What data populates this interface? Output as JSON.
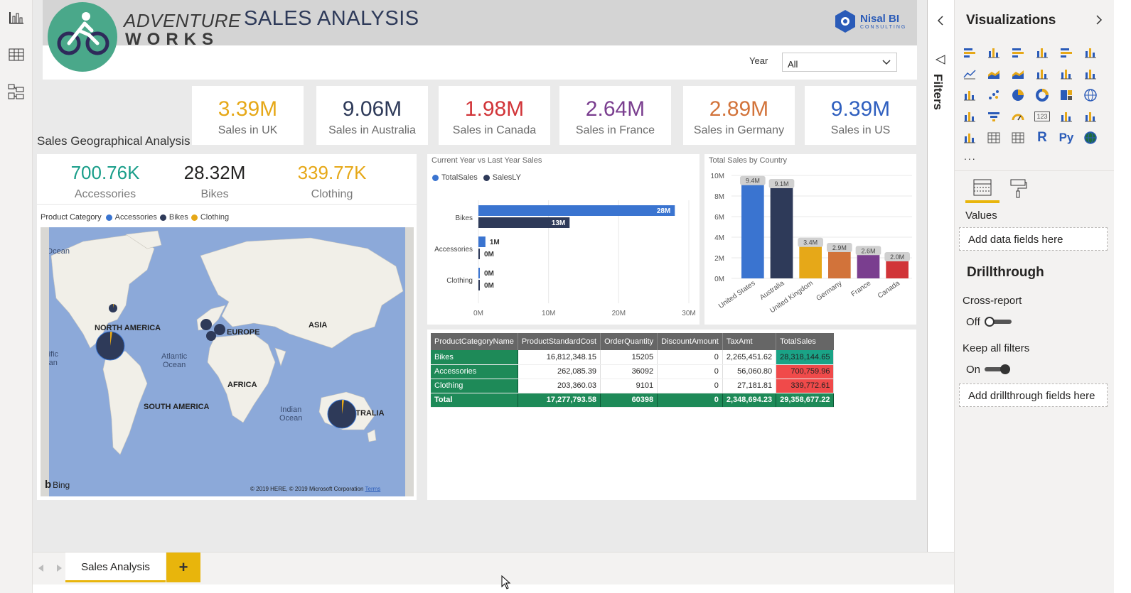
{
  "left_nav": {
    "items": [
      "report-view-icon",
      "data-view-icon",
      "model-view-icon"
    ]
  },
  "header": {
    "brand_line1": "ADVENTURE",
    "brand_line2": "WORKS",
    "title": "SALES ANALYSIS",
    "partner_name": "Nisal BI",
    "partner_sub": "CONSULTING"
  },
  "year_filter": {
    "label": "Year",
    "value": "All"
  },
  "kpis": [
    {
      "value": "3.39M",
      "label": "Sales in UK",
      "color": "#e6a818"
    },
    {
      "value": "9.06M",
      "label": "Sales in Australia",
      "color": "#2e3a59"
    },
    {
      "value": "1.98M",
      "label": "Sales in Canada",
      "color": "#d13438"
    },
    {
      "value": "2.64M",
      "label": "Sales in France",
      "color": "#7a3e8f"
    },
    {
      "value": "2.89M",
      "label": "Sales in Germany",
      "color": "#d2733a"
    },
    {
      "value": "9.39M",
      "label": "Sales in US",
      "color": "#2f5fbf"
    }
  ],
  "geo": {
    "title": "Sales Geographical Analysis",
    "category_kpis": [
      {
        "value": "700.76K",
        "label": "Accessories",
        "color": "#1a9e8a"
      },
      {
        "value": "28.32M",
        "label": "Bikes",
        "color": "#252423"
      },
      {
        "value": "339.77K",
        "label": "Clothing",
        "color": "#e6a818"
      }
    ],
    "legend_title": "Product Category",
    "legend": [
      {
        "name": "Accessories",
        "color": "#3a74d0"
      },
      {
        "name": "Bikes",
        "color": "#2e3a59"
      },
      {
        "name": "Clothing",
        "color": "#e6a818"
      }
    ],
    "map_labels": {
      "north_america": "NORTH AMERICA",
      "europe": "EUROPE",
      "asia": "ASIA",
      "africa": "AFRICA",
      "south_america": "SOUTH AMERICA",
      "australia": "AUSTRALIA",
      "atlantic": "Atlantic\nOcean",
      "indian": "Indian\nOcean",
      "arctic_fragment": "c Ocean",
      "pacific_fragment": "acific\ncean",
      "bing": "Bing",
      "copyright": "© 2019 HERE, © 2019 Microsoft Corporation",
      "terms": "Terms"
    }
  },
  "chart_data": [
    {
      "type": "bar",
      "title": "Current Year vs Last Year Sales",
      "categories": [
        "Bikes",
        "Accessories",
        "Clothing"
      ],
      "series": [
        {
          "name": "TotalSales",
          "values": [
            28,
            1,
            0
          ],
          "labels": [
            "28M",
            "1M",
            "0M"
          ],
          "color": "#3a74d0"
        },
        {
          "name": "SalesLY",
          "values": [
            13,
            0,
            0
          ],
          "labels": [
            "13M",
            "0M",
            "0M"
          ],
          "color": "#2e3a59"
        }
      ],
      "xlim": [
        0,
        30
      ],
      "xticks": [
        "0M",
        "10M",
        "20M",
        "30M"
      ]
    },
    {
      "type": "bar",
      "title": "Total Sales by Country",
      "categories": [
        "United States",
        "Australia",
        "United Kingdom",
        "Germany",
        "France",
        "Canada"
      ],
      "values": [
        9.4,
        9.1,
        3.4,
        2.9,
        2.6,
        2.0
      ],
      "labels": [
        "9.4M",
        "9.1M",
        "3.4M",
        "2.9M",
        "2.6M",
        "2.0M"
      ],
      "colors": [
        "#3a74d0",
        "#2e3a59",
        "#e6a818",
        "#d2733a",
        "#7a3e8f",
        "#d13438"
      ],
      "ylim": [
        0,
        10
      ],
      "yticks": [
        "0M",
        "2M",
        "4M",
        "6M",
        "8M",
        "10M"
      ]
    }
  ],
  "matrix": {
    "headers": [
      "ProductCategoryName",
      "ProductStandardCost",
      "OrderQuantity",
      "DiscountAmount",
      "TaxAmt",
      "TotalSales"
    ],
    "rows": [
      [
        "Bikes",
        "16,812,348.15",
        "15205",
        "0",
        "2,265,451.62",
        "28,318,144.65"
      ],
      [
        "Accessories",
        "262,085.39",
        "36092",
        "0",
        "56,060.80",
        "700,759.96"
      ],
      [
        "Clothing",
        "203,360.03",
        "9101",
        "0",
        "27,181.81",
        "339,772.61"
      ]
    ],
    "total": [
      "Total",
      "17,277,793.58",
      "60398",
      "0",
      "2,348,694.23",
      "29,358,677.22"
    ],
    "total_sales_colors": [
      "#1aa386",
      "#f04a4a",
      "#f04a4a"
    ]
  },
  "tabs": {
    "active": "Sales Analysis",
    "add": "+"
  },
  "filters_pane": {
    "label": "Filters"
  },
  "visualizations": {
    "title": "Visualizations",
    "more": "...",
    "values_label": "Values",
    "values_well": "Add data fields here",
    "drillthrough_title": "Drillthrough",
    "cross_report_label": "Cross-report",
    "cross_report_state": "Off",
    "keep_filters_label": "Keep all filters",
    "keep_filters_state": "On",
    "drillthrough_well": "Add drillthrough fields here",
    "r_label": "R",
    "py_label": "Py",
    "card_label": "123"
  }
}
